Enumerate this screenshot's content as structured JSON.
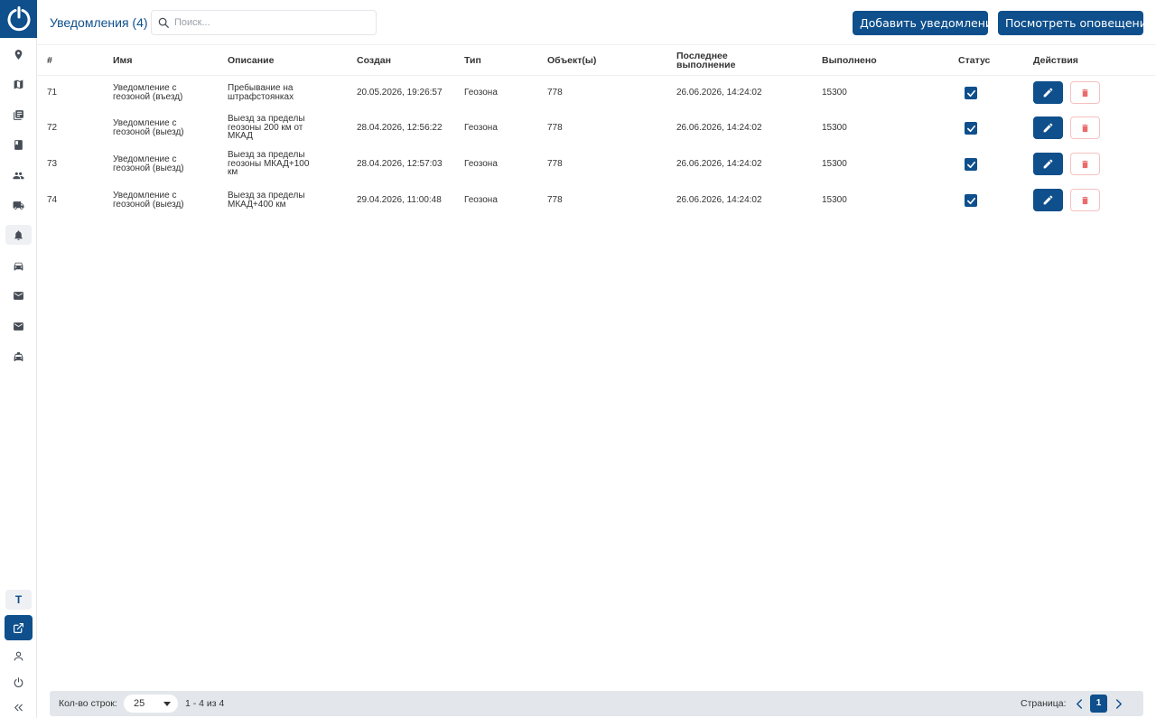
{
  "header": {
    "title": "Уведомления (4)",
    "search_placeholder": "Поиск...",
    "add_label": "Добавить уведомления",
    "view_label": "Посмотреть оповещения"
  },
  "sidebar": {
    "items": [
      {
        "icon": "location-pin-icon"
      },
      {
        "icon": "map-icon"
      },
      {
        "icon": "reports-icon"
      },
      {
        "icon": "book-icon"
      },
      {
        "icon": "users-icon"
      },
      {
        "icon": "truck-icon"
      },
      {
        "icon": "bell-icon",
        "active": true
      },
      {
        "icon": "car-icon"
      },
      {
        "icon": "mail-icon"
      },
      {
        "icon": "mail-icon"
      },
      {
        "icon": "taxi-icon"
      }
    ],
    "letter_badge": "T",
    "bottom": [
      "external-link-icon",
      "user-icon",
      "power-icon",
      "collapse-icon"
    ]
  },
  "table": {
    "columns": [
      "#",
      "Имя",
      "Описание",
      "Создан",
      "Тип",
      "Объект(ы)",
      "Последнее выполнение",
      "Выполнено",
      "Статус",
      "Действия"
    ],
    "rows": [
      {
        "id": "71",
        "name": "Уведомление с геозоной (въезд)",
        "desc": "Пребывание на штрафстоянках",
        "created": "20.05.2026, 19:26:57",
        "type": "Геозона",
        "objects": "778",
        "last": "26.06.2026, 14:24:02",
        "done": "15300",
        "status": true
      },
      {
        "id": "72",
        "name": "Уведомление с геозоной (выезд)",
        "desc": "Выезд за пределы геозоны 200 км от МКАД",
        "created": "28.04.2026, 12:56:22",
        "type": "Геозона",
        "objects": "778",
        "last": "26.06.2026, 14:24:02",
        "done": "15300",
        "status": true
      },
      {
        "id": "73",
        "name": "Уведомление с геозоной (выезд)",
        "desc": "Выезд за пределы геозоны МКАД+100 км",
        "created": "28.04.2026, 12:57:03",
        "type": "Геозона",
        "objects": "778",
        "last": "26.06.2026, 14:24:02",
        "done": "15300",
        "status": true
      },
      {
        "id": "74",
        "name": "Уведомление с геозоной (выезд)",
        "desc": "Выезд за пределы МКАД+400 км",
        "created": "29.04.2026, 11:00:48",
        "type": "Геозона",
        "objects": "778",
        "last": "26.06.2026, 14:24:02",
        "done": "15300",
        "status": true
      }
    ]
  },
  "footer": {
    "rows_label": "Кол-во строк:",
    "rows_value": "25",
    "range": "1 - 4 из 4",
    "page_label": "Страница:",
    "page": "1"
  },
  "colors": {
    "primary": "#0e4f8c",
    "danger": "#ea6b6b",
    "footer_bg": "#e3e7ec"
  }
}
